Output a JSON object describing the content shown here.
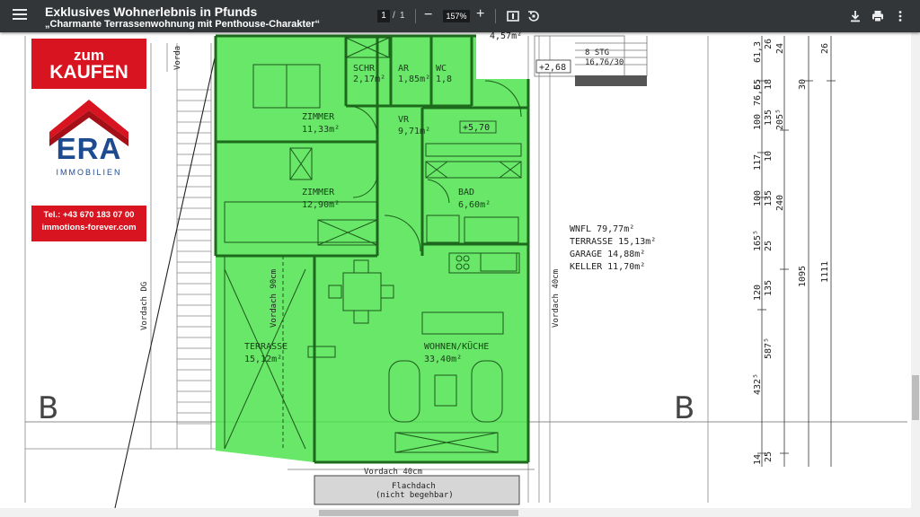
{
  "viewer": {
    "title": "Exklusives Wohnerlebnis in Pfunds",
    "subtitle": "„Charmante Terrassenwohnung mit Penthouse-Charakter“",
    "page_current": "1",
    "page_separator": "/",
    "page_total": "1",
    "zoom": "157%",
    "zoom_out": "−",
    "zoom_in": "+",
    "icons": [
      "menu-icon",
      "fit-page-icon",
      "rotate-icon",
      "download-icon",
      "print-icon",
      "more-options-icon"
    ]
  },
  "ad": {
    "line1": "zum",
    "line2": "KAUFEN",
    "brand": "ERA",
    "subbrand": "IMMOBILIEN",
    "phone": "Tel.: +43 670 183 07 00",
    "website": "immotions-forever.com",
    "colors": {
      "red": "#d7141f",
      "blue": "#1e4b8f"
    }
  },
  "plan": {
    "highlight_color": "#4ee34e",
    "rooms": {
      "schr": {
        "name": "SCHR",
        "area": "2,17m²"
      },
      "ar": {
        "name": "AR",
        "area": "1,85m²"
      },
      "wc": {
        "name": "WC",
        "area": "1,8"
      },
      "vr": {
        "name": "VR",
        "area": "9,71m²"
      },
      "zimmer1": {
        "name": "ZIMMER",
        "area": "11,33m²"
      },
      "zimmer2": {
        "name": "ZIMMER",
        "area": "12,90m²"
      },
      "bad": {
        "name": "BAD",
        "area": "6,60m²"
      },
      "terrasse": {
        "name": "TERRASSE",
        "area": "15,12m²"
      },
      "wohnen": {
        "name": "WOHNEN/KÜCHE",
        "area": "33,40m²"
      }
    },
    "level_5": "+5,70",
    "level_2": "+2,68",
    "stairs_label": "8 STG",
    "stairs_dims": "16,76/30",
    "top_dim": "4,57m²",
    "vordach_dg": "Vordach DG",
    "vordach_90": "Vordach 90cm",
    "vordach_40_right": "Vordach 40cm",
    "vordach_40_bottom": "Vordach 40cm",
    "vordach_top": "Vorda",
    "flachdach": "Flachdach",
    "flachdach_note": "(nicht begehbar)",
    "section_left": "B",
    "section_right": "B",
    "summary": {
      "wnfl": "WNFL 79,77m²",
      "terrasse": "TERRASSE 15,13m²",
      "garage": "GARAGE 14,88m²",
      "keller": "KELLER 11,70m²"
    },
    "dims": {
      "c1": [
        "61,3",
        "65",
        "76,5",
        "100",
        "117",
        "100",
        "165⁵",
        "120",
        "432⁵",
        "14"
      ],
      "c2": [
        "26",
        "18",
        "135",
        "10",
        "135",
        "25",
        "135",
        "587⁵",
        "25"
      ],
      "c3": [
        "24",
        "205⁵",
        "240"
      ],
      "c4": [
        "30",
        "1095"
      ],
      "c5": [
        "26",
        "1111"
      ]
    }
  }
}
